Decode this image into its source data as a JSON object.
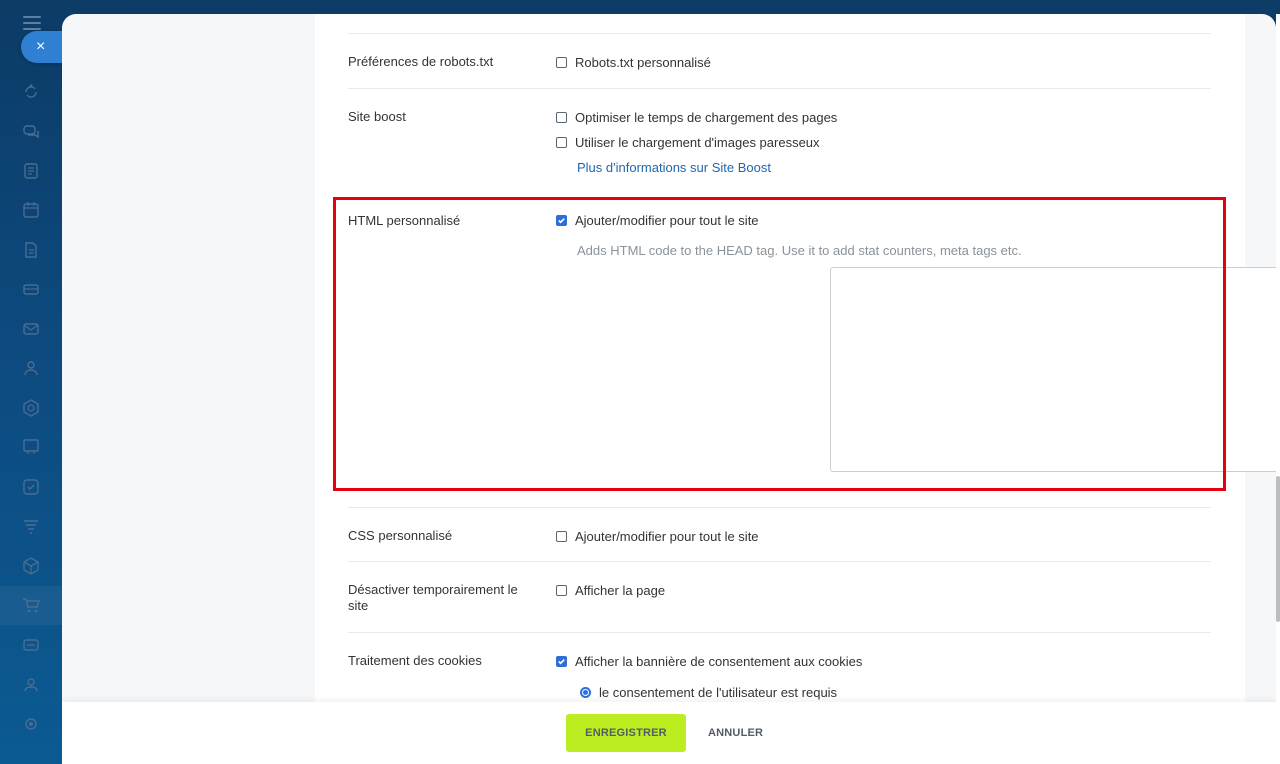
{
  "sidebar": {
    "close_glyph": "×",
    "icons": [
      "sync-icon",
      "chat-icon",
      "feed-icon",
      "calendar-icon",
      "document-icon",
      "storage-icon",
      "mail-icon",
      "contacts-icon",
      "hexagon-icon",
      "board-icon",
      "check-icon",
      "filter-icon",
      "cube-icon",
      "cart-icon",
      "card-icon",
      "group-icon",
      "settings-icon"
    ]
  },
  "settings": {
    "robots": {
      "label": "Préférences de robots.txt",
      "option": "Robots.txt personnalisé"
    },
    "boost": {
      "label": "Site boost",
      "option1": "Optimiser le temps de chargement des pages",
      "option2": "Utiliser le chargement d'images paresseux",
      "link": "Plus d'informations sur Site Boost"
    },
    "html": {
      "label": "HTML personnalisé",
      "option": "Ajouter/modifier pour tout le site",
      "hint": "Adds HTML code to the HEAD tag. Use it to add stat counters, meta tags etc.",
      "value": ""
    },
    "css": {
      "label": "CSS personnalisé",
      "option": "Ajouter/modifier pour tout le site"
    },
    "disable": {
      "label": "Désactiver temporairement le site",
      "option": "Afficher la page"
    },
    "cookies": {
      "label": "Traitement des cookies",
      "option": "Afficher la bannière de consentement aux cookies",
      "radio": "le consentement de l'utilisateur est requis"
    }
  },
  "footer": {
    "save_label": "ENREGISTRER",
    "cancel_label": "ANNULER"
  },
  "colors": {
    "highlight": "#e4000f",
    "save": "#bbed21",
    "checkbox": "#2d6fd6",
    "link": "#2067b0"
  }
}
